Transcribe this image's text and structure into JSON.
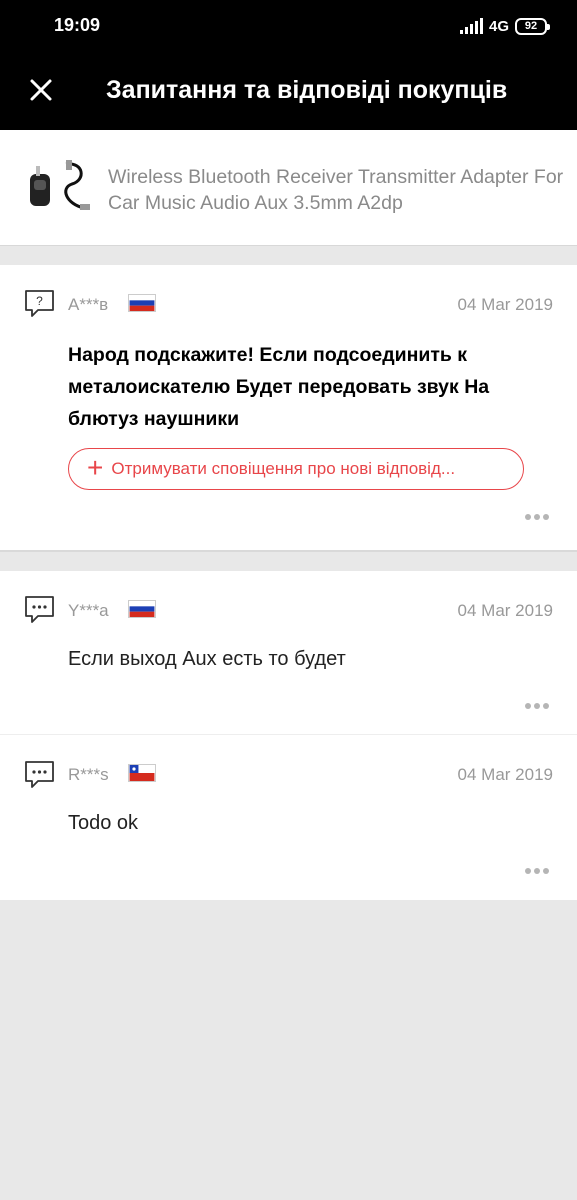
{
  "status_bar": {
    "time": "19:09",
    "network": "4G",
    "battery": "92"
  },
  "header": {
    "title": "Запитання та відповіді покупців"
  },
  "product": {
    "title": "Wireless Bluetooth Receiver Transmitter Adapter For Car Music Audio Aux 3.5mm A2dp"
  },
  "question": {
    "user": "А***в",
    "country": "RU",
    "date": "04 Mar 2019",
    "text": "Народ подскажите! Если подсоединить к металоискателю Будет передовать звук На блютуз наушники",
    "follow_label": "Отримувати сповіщення про нові відповід..."
  },
  "answers": [
    {
      "user": "Y***a",
      "country": "RU",
      "date": "04 Mar 2019",
      "text": "Если выход Aux есть то будет"
    },
    {
      "user": "R***s",
      "country": "CL",
      "date": "04 Mar 2019",
      "text": "Todo ok"
    }
  ],
  "colors": {
    "accent": "#e8464a",
    "header_bg": "#000000",
    "page_bg": "#e8e8e8"
  }
}
